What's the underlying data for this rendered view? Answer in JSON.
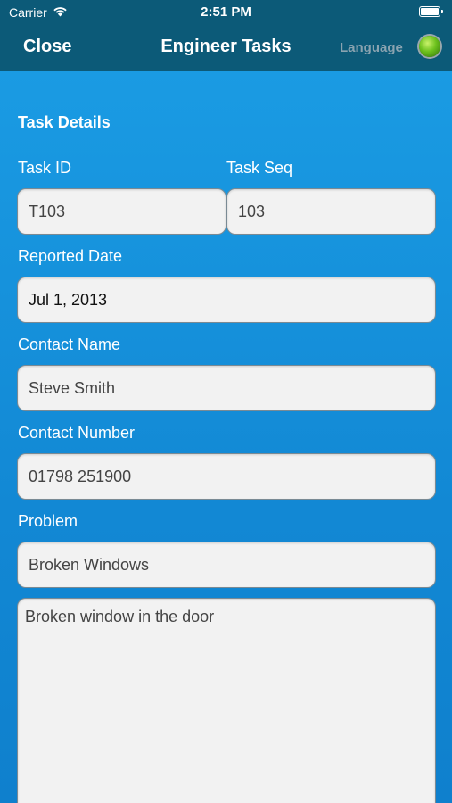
{
  "status_bar": {
    "carrier": "Carrier",
    "time": "2:51 PM",
    "wifi_icon": "wifi-icon",
    "battery_icon": "battery-icon",
    "battery_level": 1.0
  },
  "nav": {
    "close_label": "Close",
    "title": "Engineer Tasks",
    "language_label": "Language",
    "language_indicator_icon": "green-orb-icon"
  },
  "form": {
    "section_title": "Task Details",
    "task_id": {
      "label": "Task ID",
      "value": "T103"
    },
    "task_seq": {
      "label": "Task Seq",
      "value": "103"
    },
    "reported_date": {
      "label": "Reported Date",
      "value": "Jul 1, 2013"
    },
    "contact_name": {
      "label": "Contact Name",
      "value": "Steve Smith"
    },
    "contact_number": {
      "label": "Contact Number",
      "value": "01798 251900"
    },
    "problem": {
      "label": "Problem",
      "value": "Broken Windows"
    },
    "problem_description": {
      "value": "Broken window in the door"
    }
  },
  "colors": {
    "nav_background": "#0c5a78",
    "content_background": "#1a8fd8",
    "field_background": "#f2f2f2",
    "language_inactive": "#8aa3b0"
  }
}
